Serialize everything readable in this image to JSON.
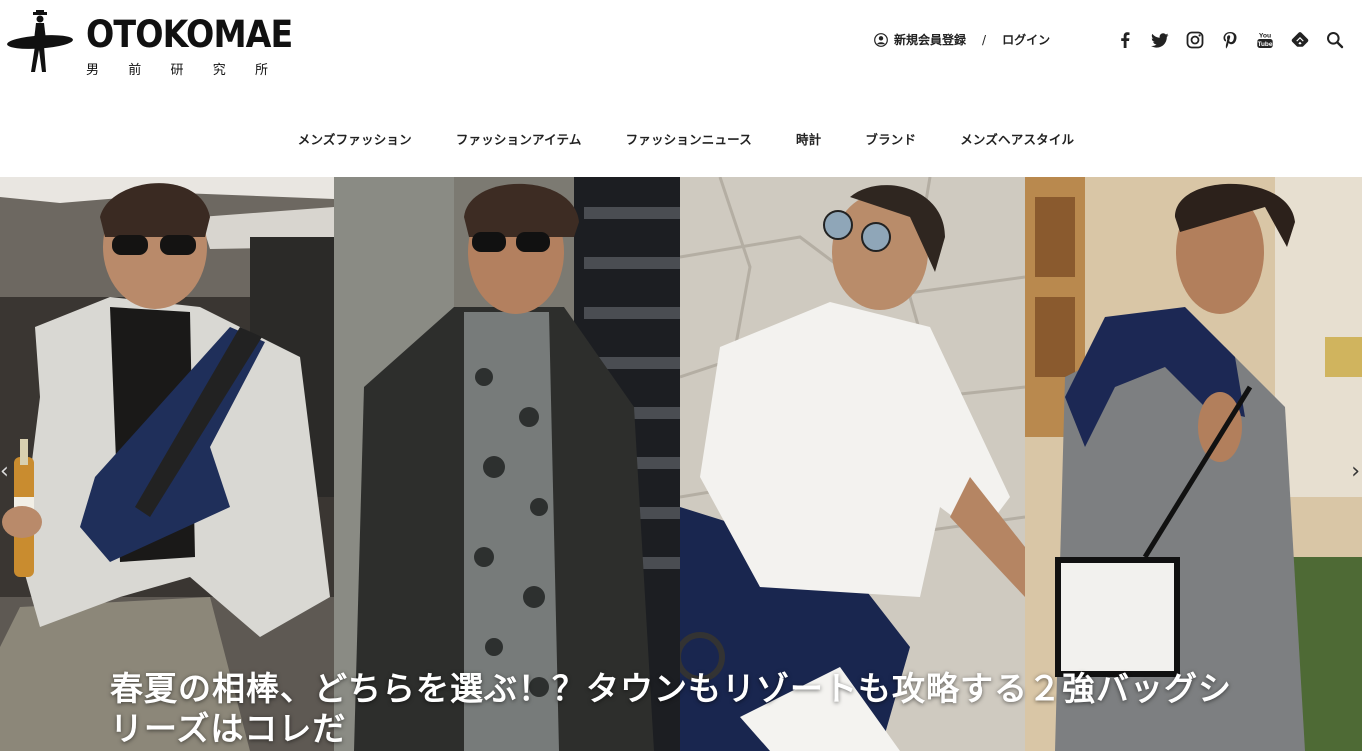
{
  "brand": {
    "logo_text": "OTOKOMAE",
    "logo_sub": [
      "男",
      "前",
      "研",
      "究",
      "所"
    ]
  },
  "account": {
    "register_label": "新規会員登録",
    "separator": "/",
    "login_label": "ログイン"
  },
  "social_icons": [
    "facebook-icon",
    "twitter-icon",
    "instagram-icon",
    "pinterest-icon",
    "youtube-icon",
    "feedly-icon",
    "search-icon"
  ],
  "nav": {
    "items": [
      "メンズファッション",
      "ファッションアイテム",
      "ファッションニュース",
      "時計",
      "ブランド",
      "メンズヘアスタイル"
    ]
  },
  "hero": {
    "title": "春夏の相棒、どちらを選ぶ！？タウンもリゾートも攻略する２強バッグシリーズはコレだ",
    "prev_arrow": "‹",
    "next_arrow": "›"
  },
  "colors": {
    "text": "#222222",
    "nav_text": "#222222",
    "hero_title": "#ffffff"
  }
}
